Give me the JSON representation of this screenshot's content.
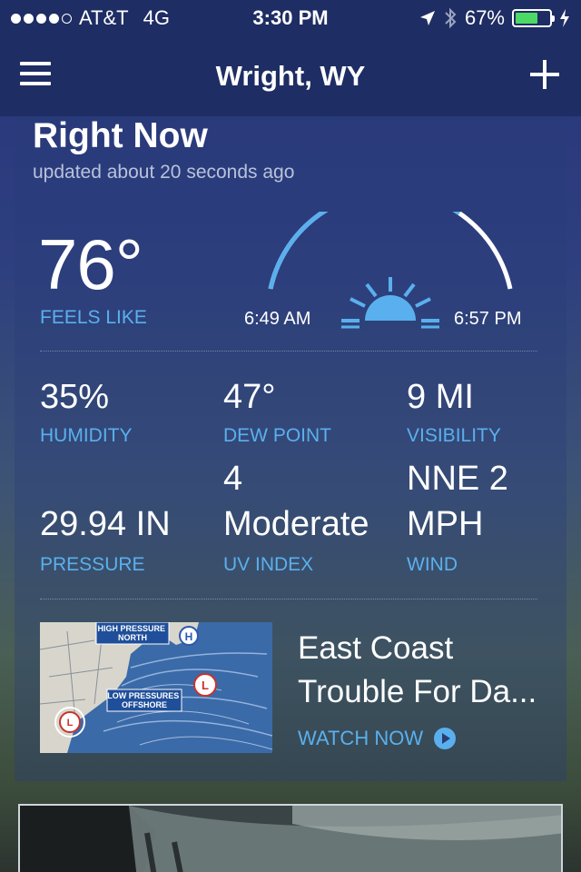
{
  "status_bar": {
    "carrier": "AT&T",
    "network": "4G",
    "time": "3:30 PM",
    "battery": "67%",
    "battery_level": 0.67,
    "signal_bars_filled": 4,
    "signal_bars_total": 5
  },
  "nav": {
    "title": "Wright, WY"
  },
  "right_now": {
    "title": "Right Now",
    "updated": "updated about 20 seconds ago",
    "temperature": "76°",
    "feels_like_label": "FEELS LIKE",
    "sunrise": "6:49 AM",
    "sunset": "6:57 PM",
    "daylight_progress": 0.72
  },
  "stats": {
    "humidity": {
      "value": "35%",
      "label": "HUMIDITY"
    },
    "dew_point": {
      "value": "47°",
      "label": "DEW POINT"
    },
    "visibility": {
      "value": "9 MI",
      "label": "VISIBILITY"
    },
    "pressure": {
      "value": "29.94 IN",
      "label": "PRESSURE"
    },
    "uv_index": {
      "value_line1": "4",
      "value_line2": "Moderate",
      "label": "UV INDEX"
    },
    "wind": {
      "value_line1": "NNE 2",
      "value_line2": "MPH",
      "label": "WIND"
    }
  },
  "news": {
    "title": "East Coast Trouble For Da...",
    "watch_label": "WATCH NOW",
    "map_label_high": "HIGH PRESSURE NORTH",
    "map_label_low": "LOW PRESSURES OFFSHORE",
    "map_high_symbol": "H",
    "map_low_symbol": "L"
  },
  "colors": {
    "accent": "#5ab0ee",
    "bar_bg": "#1e2d63",
    "sun": "#5ab0ee"
  },
  "icons": {
    "menu": "hamburger-menu-icon",
    "add": "plus-icon",
    "location": "location-arrow-icon",
    "bluetooth": "bluetooth-icon",
    "charging": "lightning-bolt-icon",
    "play": "play-circle-icon",
    "sun": "sun-icon"
  }
}
